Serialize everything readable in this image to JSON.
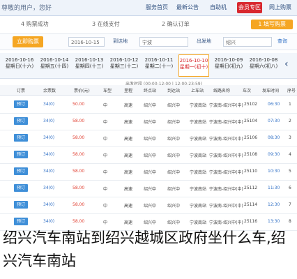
{
  "topbar": {
    "title": "尊敬的用户，您好",
    "tabs": [
      "服务首页",
      "最新公告",
      "自助机",
      "会员专区",
      "网上购票",
      "帮助"
    ]
  },
  "steps": [
    "1 填写购票",
    "2 确认订单",
    "3 在线支付",
    "4 购票成功"
  ],
  "search": {
    "button": "立即购票",
    "from_label": "出发地",
    "from_value": "绍兴",
    "date_value": "2016-10-15",
    "to_label": "到达地",
    "to_value": "宁波",
    "search_label": "查询"
  },
  "dates": [
    {
      "d1": "2016-10-16",
      "d2": "星期日(十六)"
    },
    {
      "d1": "2016-10-14",
      "d2": "星期五(十四)"
    },
    {
      "d1": "2016-10-13",
      "d2": "星期四(十三)"
    },
    {
      "d1": "2016-10-12",
      "d2": "星期三(十二)"
    },
    {
      "d1": "2016-10-11",
      "d2": "星期二(十一)"
    },
    {
      "d1": "2016-10-10",
      "d2": "星期一(初十)"
    },
    {
      "d1": "2016-10-09",
      "d2": "星期日(初九)"
    },
    {
      "d1": "2016-10-08",
      "d2": "星期六(初八)"
    }
  ],
  "info": "出发时段 (00:00-12:00 | 12:00-23:59)",
  "columns": [
    "订票",
    "余票数",
    "票价(元)",
    "车型",
    "里程",
    "终点站",
    "到达站",
    "上车站",
    "线路名称",
    "车次",
    "发车时间",
    "序号"
  ],
  "rows": [
    {
      "seats": "34(0)",
      "price": "50.00",
      "type": "中",
      "dist": "高速",
      "term": "绍兴中",
      "arr": "绍兴中",
      "board": "宁波南站",
      "line": "宁波南-绍兴中(中)",
      "no": "25102",
      "time": "06:30",
      "idx": "1"
    },
    {
      "seats": "34(0)",
      "price": "58.00",
      "type": "中",
      "dist": "高速",
      "term": "绍兴中",
      "arr": "绍兴中",
      "board": "宁波南站",
      "line": "宁波南-绍兴中(中)",
      "no": "25104",
      "time": "07:30",
      "idx": "2"
    },
    {
      "seats": "34(0)",
      "price": "58.00",
      "type": "中",
      "dist": "高速",
      "term": "绍兴中",
      "arr": "绍兴中",
      "board": "宁波南站",
      "line": "宁波南-绍兴中(中)",
      "no": "25106",
      "time": "08:30",
      "idx": "3"
    },
    {
      "seats": "34(0)",
      "price": "58.00",
      "type": "中",
      "dist": "高速",
      "term": "绍兴中",
      "arr": "绍兴中",
      "board": "宁波南站",
      "line": "宁波南-绍兴中(中)",
      "no": "25108",
      "time": "09:30",
      "idx": "4"
    },
    {
      "seats": "34(0)",
      "price": "58.00",
      "type": "中",
      "dist": "高速",
      "term": "绍兴中",
      "arr": "绍兴中",
      "board": "宁波南站",
      "line": "宁波南-绍兴中(中)",
      "no": "25110",
      "time": "10:30",
      "idx": "5"
    },
    {
      "seats": "34(0)",
      "price": "58.00",
      "type": "中",
      "dist": "高速",
      "term": "绍兴中",
      "arr": "绍兴中",
      "board": "宁波南站",
      "line": "宁波南-绍兴中(中)",
      "no": "25112",
      "time": "11:30",
      "idx": "6"
    },
    {
      "seats": "34(0)",
      "price": "58.00",
      "type": "中",
      "dist": "高速",
      "term": "绍兴中",
      "arr": "绍兴中",
      "board": "宁波南站",
      "line": "宁波南-绍兴中(中)",
      "no": "25114",
      "time": "12:30",
      "idx": "7"
    },
    {
      "seats": "34(0)",
      "price": "58.00",
      "type": "中",
      "dist": "高速",
      "term": "绍兴中",
      "arr": "绍兴中",
      "board": "宁波南站",
      "line": "宁波南-绍兴中(中)",
      "no": "25116",
      "time": "13:30",
      "idx": "8"
    }
  ],
  "book_label": "预订",
  "caption": "绍兴汽车南站到绍兴越城区政府坐什么车,绍兴汽车南站"
}
